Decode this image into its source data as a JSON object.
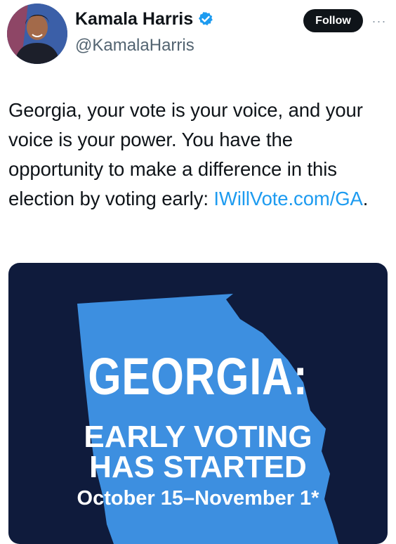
{
  "author": {
    "display_name": "Kamala Harris",
    "handle": "@KamalaHarris",
    "verified_icon": "verified-badge-icon",
    "avatar_icon": "avatar-photo"
  },
  "actions": {
    "follow_label": "Follow",
    "more_label": "···"
  },
  "tweet": {
    "text_before_link": "Georgia, your vote is your voice, and your voice is your power. You have the opportunity to make a difference in this election by voting early: ",
    "link_text": "IWillVote.com/GA",
    "text_after_link": ".",
    "link_color": "#1d9bf0"
  },
  "media": {
    "headline": "GEORGIA:",
    "line1": "EARLY VOTING",
    "line2": "HAS STARTED",
    "dates": "October 15–November 1*",
    "background_color": "#0f1b3c",
    "map_color": "#3d8fe0",
    "map_icon": "georgia-state-map"
  },
  "colors": {
    "follow_bg": "#0f1419",
    "verified": "#1d9bf0",
    "handle": "#536471"
  }
}
